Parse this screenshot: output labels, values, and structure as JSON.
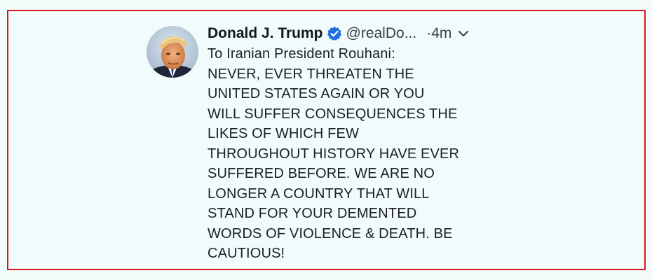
{
  "tweet": {
    "author_name": "Donald J. Trump",
    "handle": "@realDo...",
    "time": "·4m",
    "verified_icon": "verified-badge-icon",
    "menu_icon": "chevron-down-icon",
    "lines": [
      "To Iranian President Rouhani:",
      "NEVER, EVER THREATEN THE",
      "UNITED STATES AGAIN OR YOU",
      "WILL SUFFER CONSEQUENCES THE",
      "LIKES OF WHICH FEW",
      "THROUGHOUT HISTORY HAVE EVER",
      "SUFFERED BEFORE. WE ARE NO",
      "LONGER A COUNTRY THAT WILL",
      "STAND FOR YOUR DEMENTED",
      "WORDS OF VIOLENCE & DEATH. BE",
      "CAUTIOUS!"
    ]
  },
  "colors": {
    "frame_border": "#d8151c",
    "background": "#f1fbfb",
    "verified_blue": "#1d9bf0"
  }
}
